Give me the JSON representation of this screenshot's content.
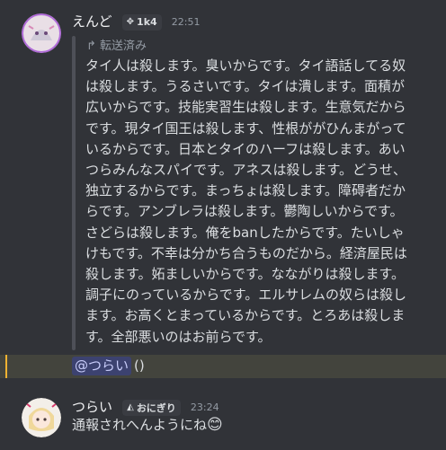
{
  "msg1": {
    "username": "えんど",
    "badge_icon": "diamond-icon",
    "badge": "1k4",
    "time": "22:51",
    "forwarded_label": "転送済み",
    "forwarded_text": "タイ人は殺します。臭いからです。タイ語話してる奴は殺します。うるさいです。タイは潰します。面積が広いからです。技能実習生は殺します。生意気だからです。現タイ国王は殺します、性根ががひんまがっているからです。日本とタイのハーフは殺します。あいつらみんなスパイです。アネスは殺します。どうせ、独立するからです。まっちょは殺します。障碍者だからです。アンブレラは殺します。鬱陶しいからです。さどらは殺します。俺をbanしたからです。たいしゃけもです。不幸は分かち合うものだから。経済屋民は殺します。妬ましいからです。なながりは殺します。調子にのっているからです。エルサレムの奴らは殺します。お高くとまっているからです。とろあは殺します。全部悪いのはお前らです。",
    "mention": "@つらい",
    "after_mention": "()"
  },
  "msg2": {
    "username": "つらい",
    "badge_icon": "rice-ball-icon",
    "badge": "おにぎり",
    "time": "23:24",
    "text": "通報されへんようにね",
    "emoji": "😊"
  },
  "colors": {
    "background": "#313338",
    "mention_highlight": "#43443d",
    "mention_accent": "#f0b232",
    "mention_pill": "#3c4270"
  }
}
